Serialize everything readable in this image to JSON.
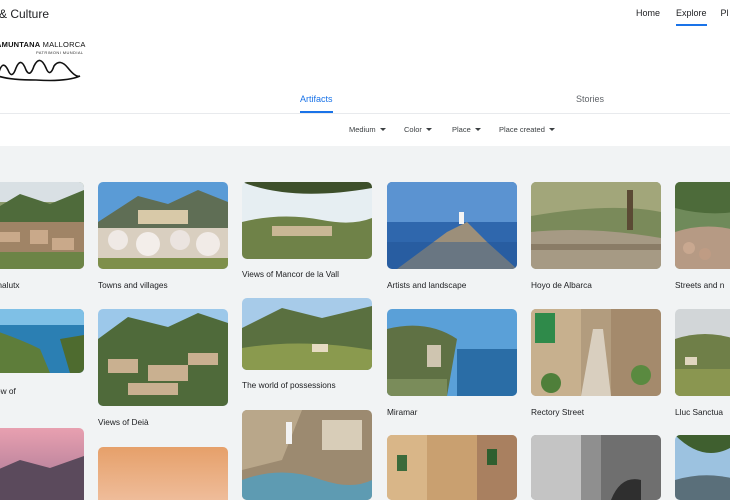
{
  "header": {
    "brand": "& Culture",
    "nav": {
      "home": "Home",
      "explore": "Explore",
      "partial": "Pl"
    }
  },
  "logo": {
    "title_bold": "AMUNTANA",
    "title_rest": " MALLORCA",
    "subtitle": "PATRIMONI MUNDIAL"
  },
  "tabs": {
    "artifacts": "Artifacts",
    "stories": "Stories"
  },
  "filters": {
    "medium": "Medium",
    "color": "Color",
    "place": "Place",
    "place_created": "Place created"
  },
  "cards": {
    "fornalutx": "ornalutx",
    "towns": "Towns and villages",
    "mancor": "Views of Mancor de la Vall",
    "artists": "Artists and landscape",
    "hoyo": "Hoyo de Albarca",
    "streets": "Streets and n",
    "view_line1": "view of",
    "view_line2": "r",
    "deia": "Views of Deià",
    "possessions": "The world of possessions",
    "miramar": "Miramar",
    "rectory": "Rectory Street",
    "lluc": "Lluc Sanctua"
  },
  "colors": {
    "accent": "#1a73e8",
    "grid_background": "#f1f3f4"
  }
}
